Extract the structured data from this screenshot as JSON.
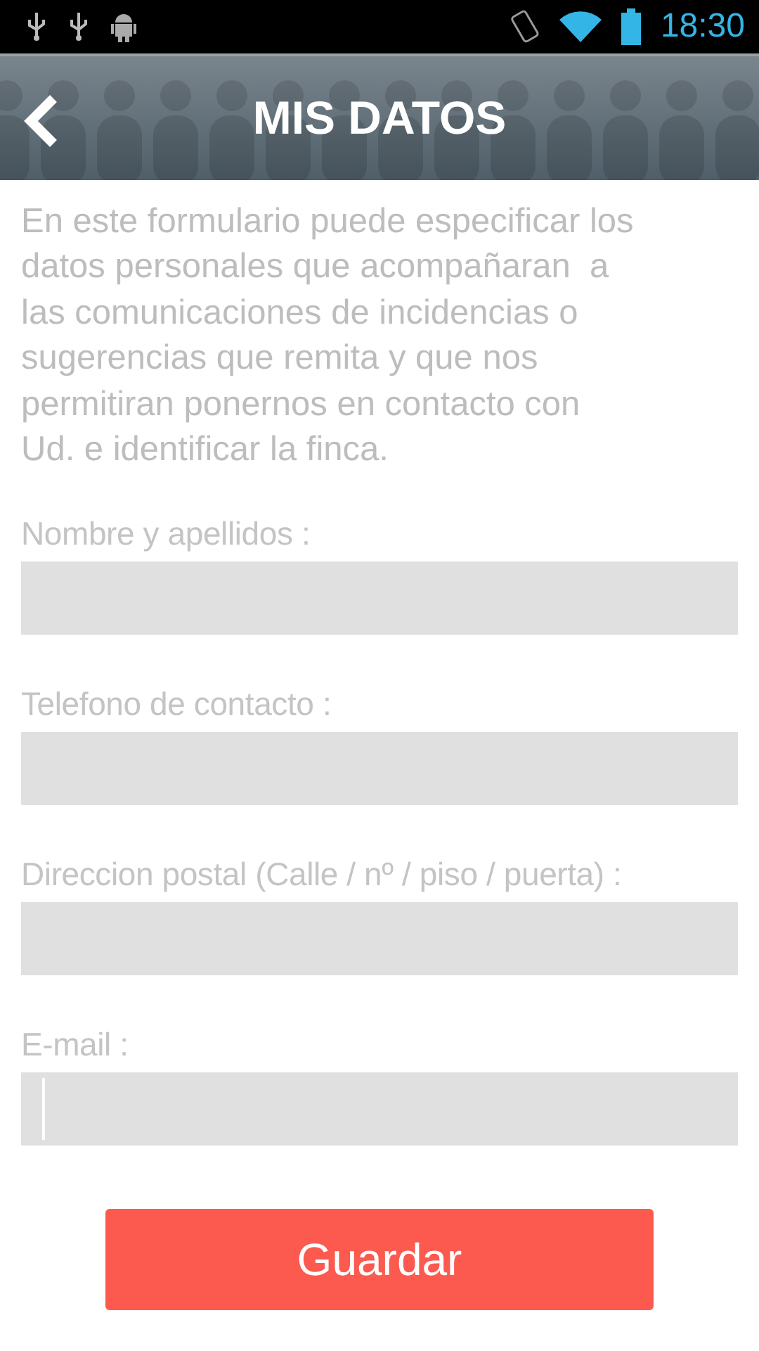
{
  "status_bar": {
    "time": "18:30"
  },
  "header": {
    "title": "MIS DATOS"
  },
  "intro": "En este formulario puede especificar los datos personales que acompañaran  a las comunicaciones de incidencias o sugerencias que remita y que nos permitiran ponernos en contacto con Ud. e identificar la finca.",
  "fields": [
    {
      "label": "Nombre y apellidos :",
      "focused": false
    },
    {
      "label": "Telefono de contacto :",
      "focused": false
    },
    {
      "label": "Direccion postal (Calle / nº / piso / puerta) :",
      "focused": false
    },
    {
      "label": "E-mail :",
      "focused": true
    }
  ],
  "save_button": "Guardar"
}
